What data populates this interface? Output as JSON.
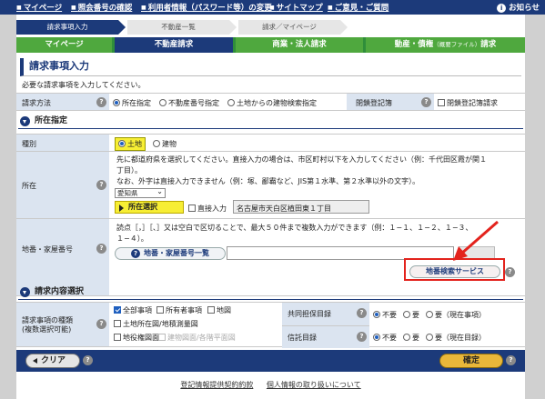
{
  "topnav": {
    "links": [
      "マイページ",
      "照会番号の確認",
      "利用者情報（パスワード等）の変更",
      "サイトマップ",
      "ご意見・ご質問"
    ],
    "notice": "お知らせ"
  },
  "steps": [
    "請求事項入力",
    "不動産一覧",
    "請求／マイページ"
  ],
  "tabs": [
    {
      "label": "マイページ"
    },
    {
      "label": "不動産請求"
    },
    {
      "label": "商業・法人請求"
    },
    {
      "label": "動産・債権",
      "sub": "（概要ファイル）",
      "tail": "請求"
    }
  ],
  "page_title": "請求事項入力",
  "intro": "必要な請求事項を入力してください。",
  "request_method": {
    "label": "請求方法",
    "options": [
      "所在指定",
      "不動産番号指定",
      "土地からの建物検索指定"
    ],
    "selected": "所在指定",
    "closed_label": "閉鎖登記簿",
    "closed_option": "閉鎖登記簿請求"
  },
  "section_location": "所在指定",
  "kind": {
    "label": "種別",
    "options": [
      "土地",
      "建物"
    ],
    "selected": "土地"
  },
  "location": {
    "label": "所在",
    "desc1": "先に都道府県を選択してください。直接入力の場合は、市区町村以下を入力してください（例：千代田区霞が関１",
    "desc1b": "丁目）。",
    "desc2": "なお、外字は直接入力できません（例：塚、鄙霸など、JIS第１水準、第２水準以外の文字）。",
    "prefecture": "愛知県",
    "select_button": "所在選択",
    "direct_input": "直接入力",
    "value": "名古屋市天白区植田東１丁目"
  },
  "lot": {
    "label": "地番・家屋番号",
    "desc1": "読点［，］［、］又は空白で区切ることで、最大５０件まで複数入力ができます（例：１−１、１−２、１−３、",
    "desc1b": "１−４）。",
    "list_button": "地番・家屋番号一覧",
    "search_service": "地番検索サービス"
  },
  "section_content": "請求内容選択",
  "request_types": {
    "label": "請求事項の種類",
    "label2": "(複数選択可能)",
    "options": [
      {
        "label": "全部事項",
        "checked": true
      },
      {
        "label": "所有者事項",
        "checked": false
      },
      {
        "label": "地図",
        "checked": false
      },
      {
        "label": "土地所在図/地積測量図",
        "checked": false
      },
      {
        "label": "地役権図面",
        "checked": false
      },
      {
        "label": "建物図面/各階平面図",
        "checked": false
      }
    ]
  },
  "joint_collateral": {
    "label": "共同担保目録",
    "options": [
      "不要",
      "要",
      "要（現在事項）"
    ],
    "selected": "不要"
  },
  "trust": {
    "label": "信託目録",
    "options": [
      "不要",
      "要",
      "要（現在目録）"
    ],
    "selected": "不要"
  },
  "buttons": {
    "clear": "クリア",
    "confirm": "確定"
  },
  "footer": {
    "terms": "登記情報提供契約約款",
    "privacy": "個人情報の取り扱いについて"
  },
  "colors": {
    "navy": "#1c3a7a",
    "green": "#4fa83e",
    "yellow": "#f7ee34",
    "annotation_red": "#e3231d"
  }
}
